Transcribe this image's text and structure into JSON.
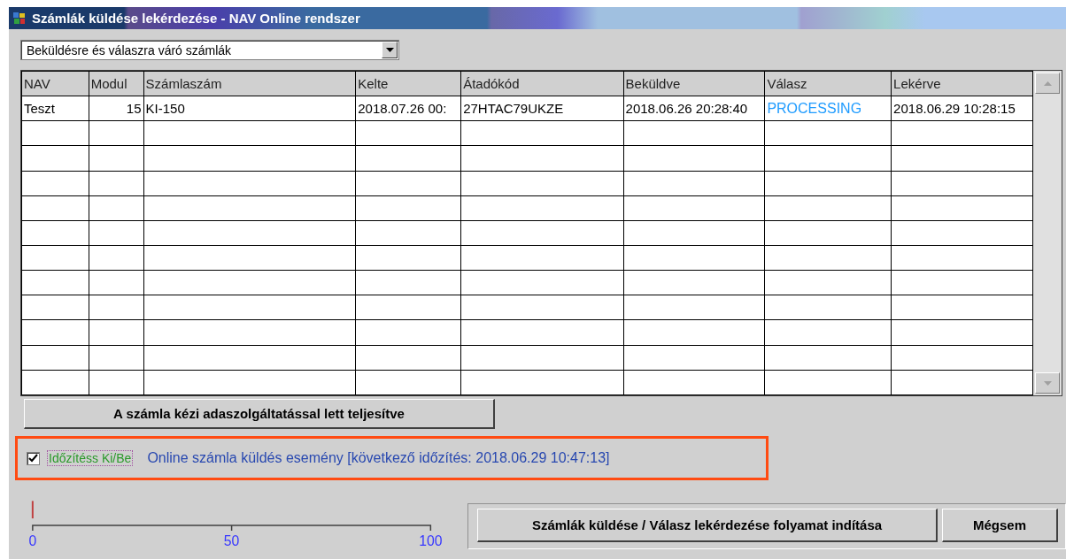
{
  "window": {
    "title": "Számlák küldése lekérdezése - NAV Online rendszer"
  },
  "filter": {
    "value": "Beküldésre és válaszra váró számlák"
  },
  "table": {
    "columns": [
      "NAV",
      "Modul",
      "Számlaszám",
      "Kelte",
      "Átadókód",
      "Beküldve",
      "Válasz",
      "Lekérve"
    ],
    "rows": [
      {
        "nav": "Teszt",
        "modul": "15",
        "szamlaszam": "KI-150",
        "kelte": "2018.07.26 00:",
        "atadokod": "27HTAC79UKZE",
        "bekuldve": "2018.06.26 20:28:40",
        "valasz": "PROCESSING",
        "lekerve": "2018.06.29 10:28:15"
      }
    ]
  },
  "manual_button": "A számla kézi adaszolgáltatással lett teljesítve",
  "timer": {
    "label": "Időzítéss Ki/Be",
    "checked": true,
    "status": "Online számla küldés esemény [következő időzítés: 2018.06.29 10:47:13]"
  },
  "progress": {
    "level": 0,
    "ticks": [
      "0",
      "50",
      "100"
    ]
  },
  "buttons": [
    "Számlák küldése / Válasz lekérdezése folyamat indítása",
    "Mégsem"
  ]
}
